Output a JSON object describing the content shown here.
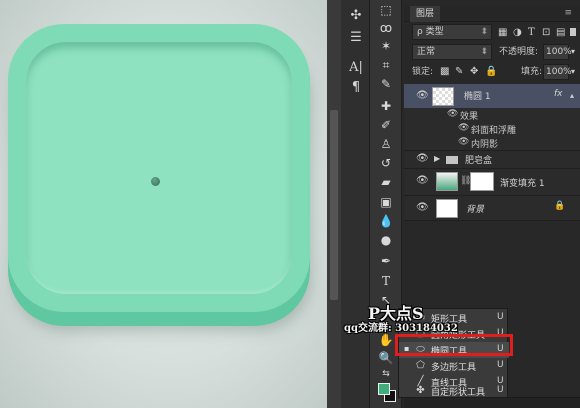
{
  "layers_panel": {
    "tab_label": "图层",
    "menu_icon": "panel-menu-icon",
    "filter_kind": "ρ 类型",
    "blend_mode": "正常",
    "opacity_label": "不透明度:",
    "opacity_value": "100%",
    "lock_label": "锁定:",
    "fill_label": "填充:",
    "fill_value": "100%",
    "layers": [
      {
        "name": "椭圆 1",
        "fx": "fx",
        "effects_label": "效果",
        "effects": [
          "斜面和浮雕",
          "内阴影"
        ]
      },
      {
        "name": "肥皂盒"
      },
      {
        "name": "渐变填充 1"
      },
      {
        "name": "背景"
      }
    ]
  },
  "flyout_menu": {
    "items": [
      {
        "label": "矩形工具",
        "key": "U",
        "icon": "rectangle-icon"
      },
      {
        "label": "圆角矩形工具",
        "key": "U",
        "icon": "rounded-rectangle-icon"
      },
      {
        "label": "椭圆工具",
        "key": "U",
        "icon": "ellipse-icon",
        "selected": true
      },
      {
        "label": "多边形工具",
        "key": "U",
        "icon": "polygon-icon"
      },
      {
        "label": "直线工具",
        "key": "U",
        "icon": "line-icon"
      },
      {
        "label": "自定形状工具",
        "key": "U",
        "icon": "custom-shape-icon"
      }
    ]
  },
  "watermark": {
    "title": "P大点S",
    "qq_group": "qq交流群: 303184032"
  },
  "colors": {
    "shape_light": "#7fdbb5",
    "shape_dark": "#5fc8a0",
    "foreground_color": "#3fae7f",
    "background_color": "#111111",
    "highlight": "#e01e1e"
  }
}
